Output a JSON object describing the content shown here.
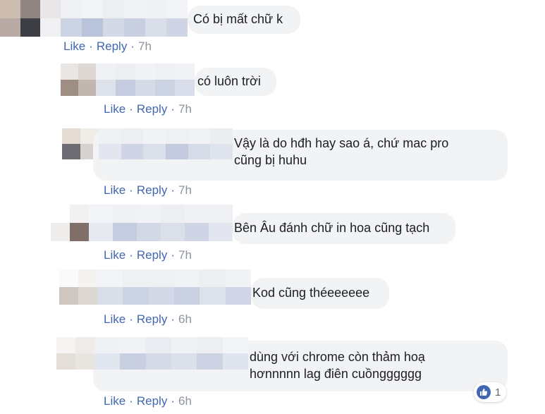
{
  "actions": {
    "like": "Like",
    "reply": "Reply",
    "separator": "·"
  },
  "comments": [
    {
      "text": "Có bị mất chữ k",
      "time": "7h"
    },
    {
      "text": "có luôn trời",
      "time": "7h"
    },
    {
      "text": "Vậy là do hđh hay sao á, chứ mac pro\ncũng bị huhu",
      "time": "7h"
    },
    {
      "text": "Bên Âu đánh chữ in hoa cũng tạch",
      "time": "7h"
    },
    {
      "text": "Kod cũng théeeeeee",
      "time": "6h"
    },
    {
      "text": "dùng với chrome còn thảm hoạ\nhơnnnnn lag điên cuồngggggg",
      "time": "6h",
      "reaction": {
        "icon": "thumbs-up-icon",
        "count": "1"
      }
    }
  ],
  "colors": {
    "link": "#4267b2",
    "bubble": "#f2f3f5",
    "meta": "#8d949e"
  }
}
